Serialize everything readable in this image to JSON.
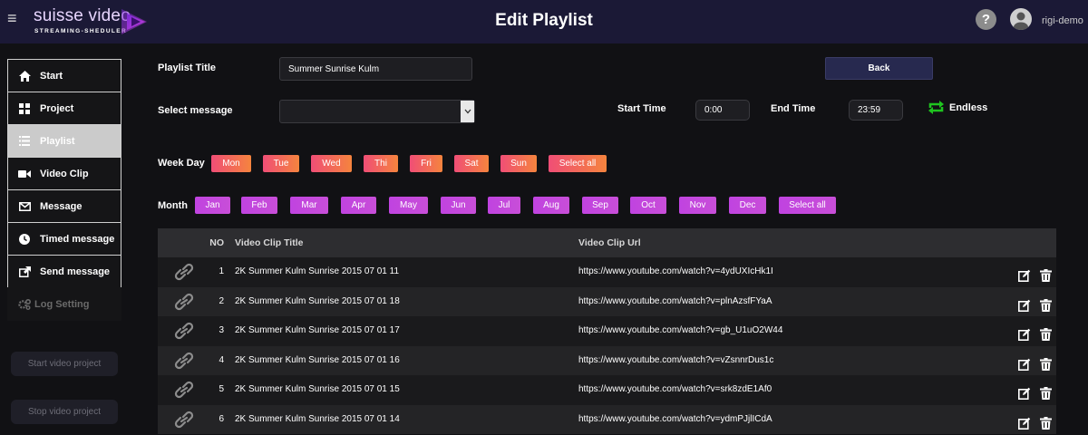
{
  "header": {
    "menu_icon": "hamburger-icon",
    "brand": "suisse video",
    "brand_sub": "STREAMING-SHEDULER",
    "title": "Edit Playlist",
    "help": "?",
    "user": "rigi-demo"
  },
  "sidebar": {
    "items": [
      {
        "label": "Start",
        "icon": "home-icon"
      },
      {
        "label": "Project",
        "icon": "grid-icon"
      },
      {
        "label": "Playlist",
        "icon": "list-icon"
      },
      {
        "label": "Video Clip",
        "icon": "video-icon"
      },
      {
        "label": "Message",
        "icon": "envelope-icon"
      },
      {
        "label": "Timed message",
        "icon": "clock-icon"
      },
      {
        "label": "Send message",
        "icon": "share-icon"
      },
      {
        "label": "Log Setting",
        "icon": "gears-icon"
      }
    ],
    "active_index": 2,
    "start_project": "Start video project",
    "stop_project": "Stop video project"
  },
  "form": {
    "title_label": "Playlist Title",
    "title_value": "Summer Sunrise Kulm",
    "message_label": "Select message",
    "message_value": "",
    "back_label": "Back",
    "start_time_label": "Start Time",
    "start_time_value": "0:00",
    "end_time_label": "End Time",
    "end_time_value": "23:59",
    "endless_label": "Endless",
    "accent_green": "#1fc41f"
  },
  "weekdays": {
    "label": "Week Day",
    "days": [
      "Mon",
      "Tue",
      "Wed",
      "Thi",
      "Fri",
      "Sat",
      "Sun"
    ],
    "select_all": "Select all"
  },
  "months": {
    "label": "Month",
    "items": [
      "Jan",
      "Feb",
      "Mar",
      "Apr",
      "May",
      "Jun",
      "Jul",
      "Aug",
      "Sep",
      "Oct",
      "Nov",
      "Dec"
    ],
    "select_all": "Select all"
  },
  "table": {
    "columns": {
      "no": "NO",
      "title": "Video Clip Title",
      "url": "Video Clip Url"
    },
    "rows": [
      {
        "no": "1",
        "title": "2K Summer Kulm Sunrise 2015 07 01 11",
        "url": "https://www.youtube.com/watch?v=4ydUXIcHk1I"
      },
      {
        "no": "2",
        "title": "2K Summer Kulm Sunrise 2015 07 01 18",
        "url": "https://www.youtube.com/watch?v=plnAzsfFYaA"
      },
      {
        "no": "3",
        "title": "2K Summer Kulm Sunrise 2015 07 01 17",
        "url": "https://www.youtube.com/watch?v=gb_U1uO2W44"
      },
      {
        "no": "4",
        "title": "2K Summer Kulm Sunrise 2015 07 01 16",
        "url": "https://www.youtube.com/watch?v=vZsnnrDus1c"
      },
      {
        "no": "5",
        "title": "2K Summer Kulm Sunrise 2015 07 01 15",
        "url": "https://www.youtube.com/watch?v=srk8zdE1Af0"
      },
      {
        "no": "6",
        "title": "2K Summer Kulm Sunrise 2015 07 01 14",
        "url": "https://www.youtube.com/watch?v=ydmPJjlICdA"
      }
    ]
  }
}
